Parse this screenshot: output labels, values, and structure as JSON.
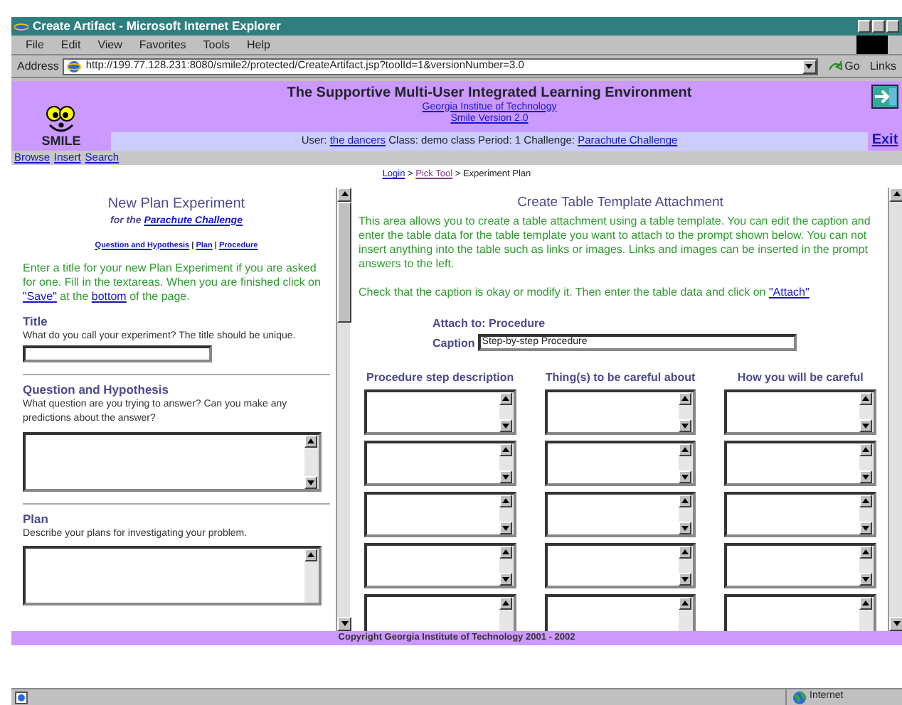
{
  "window": {
    "title": "Create Artifact - Microsoft Internet Explorer"
  },
  "menu": [
    "File",
    "Edit",
    "View",
    "Favorites",
    "Tools",
    "Help"
  ],
  "address": {
    "label": "Address",
    "url": "http://199.77.128.231:8080/smile2/protected/CreateArtifact.jsp?toolId=1&versionNumber=3.0",
    "go": "Go",
    "links": "Links"
  },
  "banner": {
    "logo_text": "SMILE",
    "title": "The Supportive Multi-User Integrated Learning Environment",
    "institution": "Georgia Institue of Technology",
    "version": "Smile Version 2.0",
    "user_label": "User:",
    "user": "the dancers",
    "class_text": "Class: demo class  Period: 1  Challenge:",
    "challenge": "Parachute Challenge",
    "exit": "Exit"
  },
  "nav_links": [
    "Browse",
    "Insert",
    "Search"
  ],
  "breadcrumb": [
    {
      "kind": "link",
      "text": "Login",
      "visited": false
    },
    {
      "kind": "link",
      "text": "Pick Tool",
      "visited": true
    },
    {
      "kind": "current",
      "text": "Experiment Plan"
    }
  ],
  "breadcrumb_separator": ">",
  "left": {
    "heading": "New Plan Experiment",
    "for_text": "for the",
    "challenge": "Parachute Challenge",
    "section_links": [
      "Question and Hypothesis",
      "Plan",
      "Procedure"
    ],
    "section_link_separator": "|",
    "intro": "Enter a title for your new Plan Experiment if you are asked for one. Fill in the textareas. When you are finished click on",
    "save_link": "\"Save\"",
    "intro_mid": "at the",
    "bottom_link": "bottom",
    "intro_end": "of the page.",
    "sections": [
      {
        "kind": "input",
        "title": "Title",
        "prompt": "What do you call your experiment? The title should be unique."
      },
      {
        "kind": "textarea",
        "title": "Question and Hypothesis",
        "prompt": "What question are you trying to answer? Can you make any predictions about the answer?"
      },
      {
        "kind": "textarea",
        "title": "Plan",
        "prompt": "Describe your plans for investigating your problem."
      }
    ]
  },
  "right": {
    "heading": "Create Table Template Attachment",
    "description": "This area allows you to create a table attachment using a table template. You can edit the caption and enter the table data for the table template you want to attach to the prompt shown below. You can not insert anything into the table such as links or images. Links and images can be inserted in the prompt answers to the left.",
    "instruction": "Check that the caption is okay or modify it. Then enter the table data and click on",
    "attach_link": "\"Attach\"",
    "attach_to": "Attach to: Procedure",
    "caption_label": "Caption",
    "caption_value": "Step-by-step Procedure",
    "columns": [
      "Procedure step description",
      "Thing(s) to be careful about",
      "How you will be careful"
    ]
  },
  "footer": "Copyright Georgia Institute of Technology 2001 - 2002",
  "status_bar": {
    "zone": "Internet"
  }
}
